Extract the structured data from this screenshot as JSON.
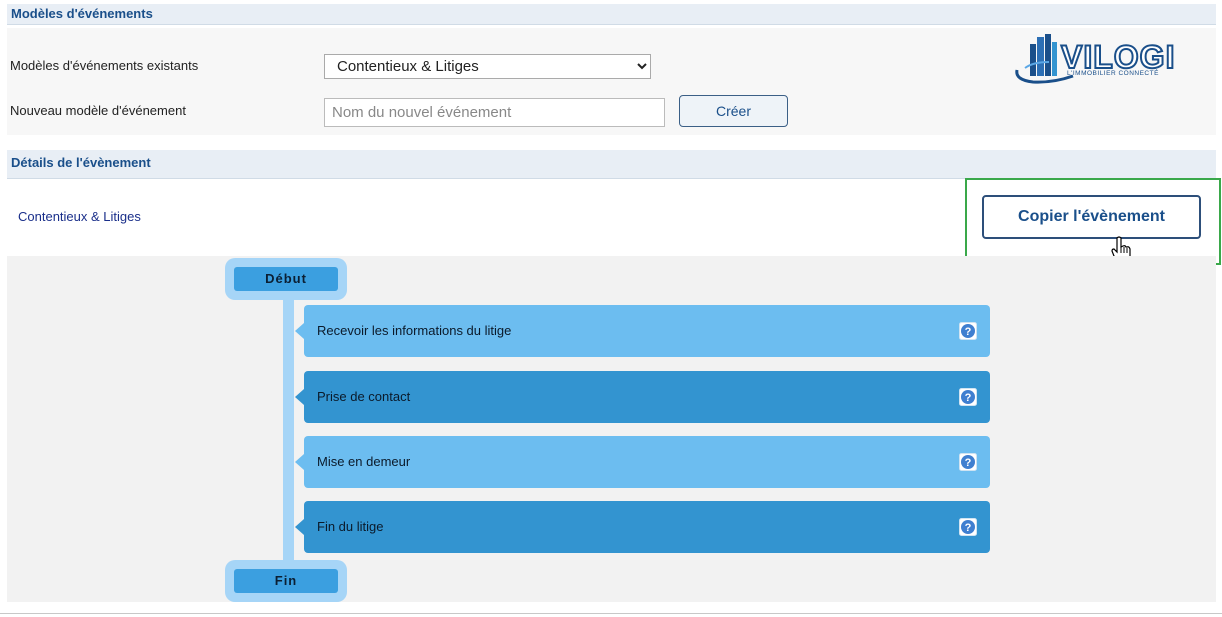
{
  "section1": {
    "title": "Modèles d'événements"
  },
  "form": {
    "existing_label": "Modèles d'événements existants",
    "existing_selected": "Contentieux & Litiges",
    "new_label": "Nouveau modèle d'événement",
    "new_placeholder": "Nom du nouvel événement",
    "create_button": "Créer"
  },
  "logo": {
    "name": "VILOGI",
    "tagline": "L'IMMOBILIER CONNECTÉ"
  },
  "section2": {
    "title": "Détails de l'évènement"
  },
  "details": {
    "event_name": "Contentieux & Litiges",
    "copy_button": "Copier l'évènement"
  },
  "flow": {
    "start": "Début",
    "end": "Fin",
    "steps": [
      {
        "label": "Recevoir les informations du litige",
        "shade": "light"
      },
      {
        "label": "Prise de contact",
        "shade": "dark"
      },
      {
        "label": "Mise en demeur",
        "shade": "light"
      },
      {
        "label": "Fin du litige",
        "shade": "dark"
      }
    ]
  },
  "colors": {
    "accent": "#1a4f8a",
    "step_light": "#6cbdf0",
    "step_dark": "#3394d0",
    "highlight_border": "#3aa84a"
  }
}
